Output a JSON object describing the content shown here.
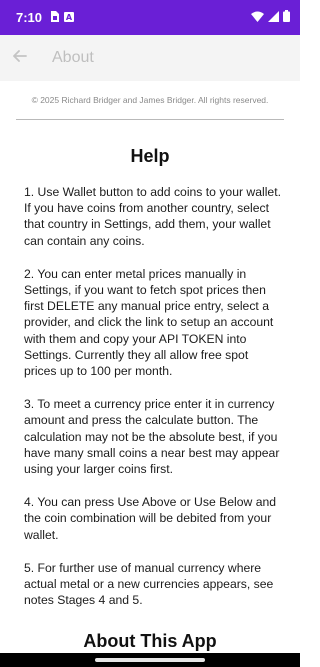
{
  "status_bar": {
    "time": "7:10",
    "background_color": "#6a1fd6",
    "left_icons": [
      "sim-card-icon",
      "notification-icon"
    ],
    "right_icons": [
      "wifi-icon",
      "signal-icon",
      "battery-icon"
    ]
  },
  "app_bar": {
    "title": "About",
    "back_icon": "arrow-left-icon"
  },
  "copyright": "© 2025 Richard Bridger and James Bridger. All rights reserved.",
  "help": {
    "title": "Help",
    "paragraphs": [
      "1. Use Wallet button to add coins to your wallet. If you have coins from another country, select that country in Settings, add them, your wallet can contain any coins.",
      "2. You can enter metal prices manually in Settings, if you want to fetch spot prices then first DELETE any manual price entry, select a provider, and click the link to setup an account with them and copy your API TOKEN into Settings. Currently they all allow free spot prices up to 100 per month.",
      "3. To meet a currency price enter it in currency amount and press the calculate button. The calculation may not be the absolute best, if you have many small coins a near best may appear using your larger coins first.",
      "4. You can press Use Above or Use Below and the coin combination will be debited from your wallet.",
      "5. For further use of manual currency where actual metal or a new currencies appears, see notes Stages 4 and 5."
    ]
  },
  "about": {
    "title": "About This App"
  }
}
